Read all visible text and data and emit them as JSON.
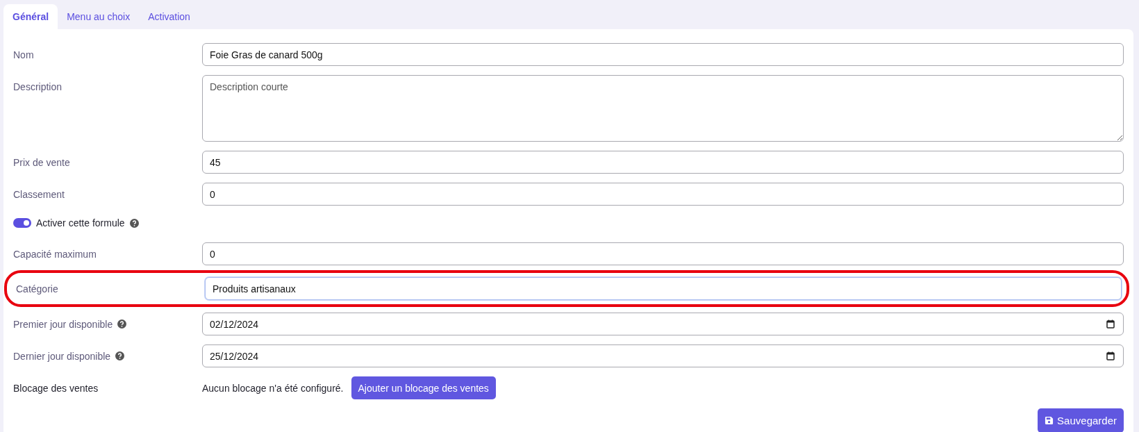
{
  "tabs": [
    {
      "label": "Général",
      "selected": true
    },
    {
      "label": "Menu au choix",
      "selected": false
    },
    {
      "label": "Activation",
      "selected": false
    }
  ],
  "rows": [
    {
      "kind": "text",
      "label": "Nom",
      "value": "Foie Gras de canard 500g"
    },
    {
      "kind": "textarea",
      "label": "Description",
      "placeholder": "Description courte"
    },
    {
      "kind": "text",
      "label": "Prix de vente",
      "value": "45"
    },
    {
      "kind": "text",
      "label": "Classement",
      "value": "0"
    },
    {
      "kind": "toggle",
      "label": "Activer cette formule",
      "on": true,
      "help": true
    },
    {
      "kind": "text",
      "label": "Capacité maximum",
      "value": "0"
    },
    {
      "kind": "text",
      "label": "Catégorie",
      "value": "Produits artisanaux",
      "highlighted": true
    },
    {
      "kind": "date",
      "label": "Premier jour disponible",
      "value": "02/12/2024",
      "help": true
    },
    {
      "kind": "date",
      "label": "Dernier jour disponible",
      "value": "25/12/2024",
      "help": true
    },
    {
      "kind": "blocage",
      "label": "Blocage des ventes",
      "text": "Aucun blocage n'a été configuré.",
      "button": "Ajouter un blocage des ventes"
    }
  ],
  "save_button": "Sauvegarder"
}
